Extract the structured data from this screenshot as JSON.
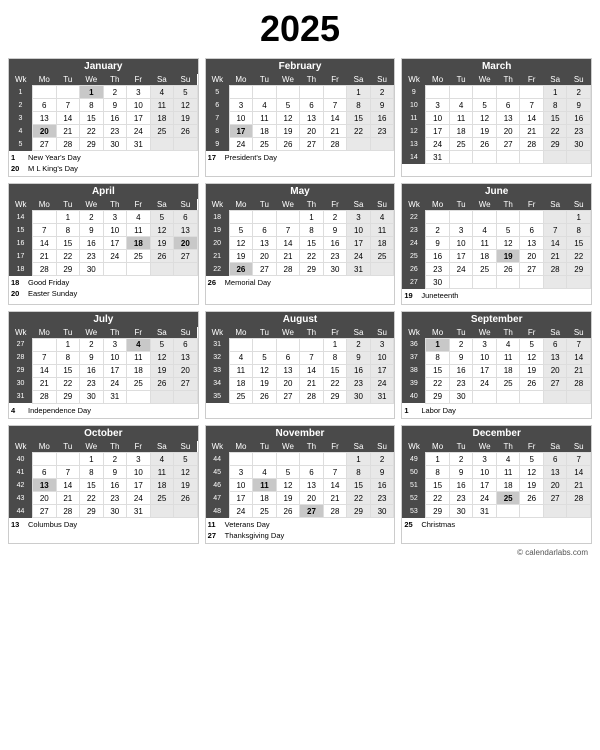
{
  "title": "2025",
  "footer": "© calendarlabs.com",
  "months": [
    {
      "name": "January",
      "headers": [
        "Wk",
        "Mo",
        "Tu",
        "We",
        "Th",
        "Fr",
        "Sa",
        "Su"
      ],
      "rows": [
        [
          "1",
          "",
          "",
          "1",
          "2",
          "3",
          "4",
          "5"
        ],
        [
          "2",
          "6",
          "7",
          "8",
          "9",
          "10",
          "11",
          "12"
        ],
        [
          "3",
          "13",
          "14",
          "15",
          "16",
          "17",
          "18",
          "19"
        ],
        [
          "4",
          "20",
          "21",
          "22",
          "23",
          "24",
          "25",
          "26"
        ],
        [
          "5",
          "27",
          "28",
          "29",
          "30",
          "31",
          "",
          ""
        ]
      ],
      "holidays": [
        {
          "date": "1",
          "name": "New Year's Day"
        },
        {
          "date": "20",
          "name": "M L King's Day"
        }
      ],
      "holiday_dates": [
        "1",
        "20"
      ],
      "sat_col": 6,
      "sun_col": 7
    },
    {
      "name": "February",
      "headers": [
        "Wk",
        "Mo",
        "Tu",
        "We",
        "Th",
        "Fr",
        "Sa",
        "Su"
      ],
      "rows": [
        [
          "5",
          "",
          "",
          "",
          "",
          "",
          "1",
          "2"
        ],
        [
          "6",
          "3",
          "4",
          "5",
          "6",
          "7",
          "8",
          "9"
        ],
        [
          "7",
          "10",
          "11",
          "12",
          "13",
          "14",
          "15",
          "16"
        ],
        [
          "8",
          "17",
          "18",
          "19",
          "20",
          "21",
          "22",
          "23"
        ],
        [
          "9",
          "24",
          "25",
          "26",
          "27",
          "28",
          "",
          ""
        ]
      ],
      "holidays": [
        {
          "date": "17",
          "name": "President's Day"
        }
      ],
      "holiday_dates": [
        "17"
      ],
      "sat_col": 6,
      "sun_col": 7
    },
    {
      "name": "March",
      "headers": [
        "Wk",
        "Mo",
        "Tu",
        "We",
        "Th",
        "Fr",
        "Sa",
        "Su"
      ],
      "rows": [
        [
          "9",
          "",
          "",
          "",
          "",
          "",
          "1",
          "2"
        ],
        [
          "10",
          "3",
          "4",
          "5",
          "6",
          "7",
          "8",
          "9"
        ],
        [
          "11",
          "10",
          "11",
          "12",
          "13",
          "14",
          "15",
          "16"
        ],
        [
          "12",
          "17",
          "18",
          "19",
          "20",
          "21",
          "22",
          "23"
        ],
        [
          "13",
          "24",
          "25",
          "26",
          "27",
          "28",
          "29",
          "30"
        ],
        [
          "14",
          "31",
          "",
          "",
          "",
          "",
          "",
          ""
        ]
      ],
      "holidays": [],
      "holiday_dates": [],
      "sat_col": 6,
      "sun_col": 7
    },
    {
      "name": "April",
      "headers": [
        "Wk",
        "Mo",
        "Tu",
        "We",
        "Th",
        "Fr",
        "Sa",
        "Su"
      ],
      "rows": [
        [
          "14",
          "",
          "1",
          "2",
          "3",
          "4",
          "5",
          "6"
        ],
        [
          "15",
          "7",
          "8",
          "9",
          "10",
          "11",
          "12",
          "13"
        ],
        [
          "16",
          "14",
          "15",
          "16",
          "17",
          "18",
          "19",
          "20"
        ],
        [
          "17",
          "21",
          "22",
          "23",
          "24",
          "25",
          "26",
          "27"
        ],
        [
          "18",
          "28",
          "29",
          "30",
          "",
          "",
          "",
          ""
        ]
      ],
      "holidays": [
        {
          "date": "18",
          "name": "Good Friday"
        },
        {
          "date": "20",
          "name": "Easter Sunday"
        }
      ],
      "holiday_dates": [
        "18",
        "20"
      ],
      "sat_col": 6,
      "sun_col": 7
    },
    {
      "name": "May",
      "headers": [
        "Wk",
        "Mo",
        "Tu",
        "We",
        "Th",
        "Fr",
        "Sa",
        "Su"
      ],
      "rows": [
        [
          "18",
          "",
          "",
          "",
          "1",
          "2",
          "3",
          "4"
        ],
        [
          "19",
          "5",
          "6",
          "7",
          "8",
          "9",
          "10",
          "11"
        ],
        [
          "20",
          "12",
          "13",
          "14",
          "15",
          "16",
          "17",
          "18"
        ],
        [
          "21",
          "19",
          "20",
          "21",
          "22",
          "23",
          "24",
          "25"
        ],
        [
          "22",
          "26",
          "27",
          "28",
          "29",
          "30",
          "31",
          ""
        ]
      ],
      "holidays": [
        {
          "date": "26",
          "name": "Memorial Day"
        }
      ],
      "holiday_dates": [
        "26"
      ],
      "sat_col": 6,
      "sun_col": 7
    },
    {
      "name": "June",
      "headers": [
        "Wk",
        "Mo",
        "Tu",
        "We",
        "Th",
        "Fr",
        "Sa",
        "Su"
      ],
      "rows": [
        [
          "22",
          "",
          "",
          "",
          "",
          "",
          "",
          "1"
        ],
        [
          "23",
          "2",
          "3",
          "4",
          "5",
          "6",
          "7",
          "8"
        ],
        [
          "24",
          "9",
          "10",
          "11",
          "12",
          "13",
          "14",
          "15"
        ],
        [
          "25",
          "16",
          "17",
          "18",
          "19",
          "20",
          "21",
          "22"
        ],
        [
          "26",
          "23",
          "24",
          "25",
          "26",
          "27",
          "28",
          "29"
        ],
        [
          "27",
          "30",
          "",
          "",
          "",
          "",
          "",
          ""
        ]
      ],
      "holidays": [
        {
          "date": "19",
          "name": "Juneteenth"
        }
      ],
      "holiday_dates": [
        "19"
      ],
      "sat_col": 6,
      "sun_col": 7
    },
    {
      "name": "July",
      "headers": [
        "Wk",
        "Mo",
        "Tu",
        "We",
        "Th",
        "Fr",
        "Sa",
        "Su"
      ],
      "rows": [
        [
          "27",
          "",
          "1",
          "2",
          "3",
          "4",
          "5",
          "6"
        ],
        [
          "28",
          "7",
          "8",
          "9",
          "10",
          "11",
          "12",
          "13"
        ],
        [
          "29",
          "14",
          "15",
          "16",
          "17",
          "18",
          "19",
          "20"
        ],
        [
          "30",
          "21",
          "22",
          "23",
          "24",
          "25",
          "26",
          "27"
        ],
        [
          "31",
          "28",
          "29",
          "30",
          "31",
          "",
          "",
          ""
        ]
      ],
      "holidays": [
        {
          "date": "4",
          "name": "Independence Day"
        }
      ],
      "holiday_dates": [
        "4"
      ],
      "sat_col": 6,
      "sun_col": 7
    },
    {
      "name": "August",
      "headers": [
        "Wk",
        "Mo",
        "Tu",
        "We",
        "Th",
        "Fr",
        "Sa",
        "Su"
      ],
      "rows": [
        [
          "31",
          "",
          "",
          "",
          "",
          "1",
          "2",
          "3"
        ],
        [
          "32",
          "4",
          "5",
          "6",
          "7",
          "8",
          "9",
          "10"
        ],
        [
          "33",
          "11",
          "12",
          "13",
          "14",
          "15",
          "16",
          "17"
        ],
        [
          "34",
          "18",
          "19",
          "20",
          "21",
          "22",
          "23",
          "24"
        ],
        [
          "35",
          "25",
          "26",
          "27",
          "28",
          "29",
          "30",
          "31"
        ]
      ],
      "holidays": [],
      "holiday_dates": [],
      "sat_col": 6,
      "sun_col": 7
    },
    {
      "name": "September",
      "headers": [
        "Wk",
        "Mo",
        "Tu",
        "We",
        "Th",
        "Fr",
        "Sa",
        "Su"
      ],
      "rows": [
        [
          "36",
          "1",
          "2",
          "3",
          "4",
          "5",
          "6",
          "7"
        ],
        [
          "37",
          "8",
          "9",
          "10",
          "11",
          "12",
          "13",
          "14"
        ],
        [
          "38",
          "15",
          "16",
          "17",
          "18",
          "19",
          "20",
          "21"
        ],
        [
          "39",
          "22",
          "23",
          "24",
          "25",
          "26",
          "27",
          "28"
        ],
        [
          "40",
          "29",
          "30",
          "",
          "",
          "",
          "",
          ""
        ]
      ],
      "holidays": [
        {
          "date": "1",
          "name": "Labor Day"
        }
      ],
      "holiday_dates": [
        "1"
      ],
      "sat_col": 6,
      "sun_col": 7
    },
    {
      "name": "October",
      "headers": [
        "Wk",
        "Mo",
        "Tu",
        "We",
        "Th",
        "Fr",
        "Sa",
        "Su"
      ],
      "rows": [
        [
          "40",
          "",
          "",
          "1",
          "2",
          "3",
          "4",
          "5"
        ],
        [
          "41",
          "6",
          "7",
          "8",
          "9",
          "10",
          "11",
          "12"
        ],
        [
          "42",
          "13",
          "14",
          "15",
          "16",
          "17",
          "18",
          "19"
        ],
        [
          "43",
          "20",
          "21",
          "22",
          "23",
          "24",
          "25",
          "26"
        ],
        [
          "44",
          "27",
          "28",
          "29",
          "30",
          "31",
          "",
          ""
        ]
      ],
      "holidays": [
        {
          "date": "13",
          "name": "Columbus Day"
        }
      ],
      "holiday_dates": [
        "13"
      ],
      "sat_col": 6,
      "sun_col": 7
    },
    {
      "name": "November",
      "headers": [
        "Wk",
        "Mo",
        "Tu",
        "We",
        "Th",
        "Fr",
        "Sa",
        "Su"
      ],
      "rows": [
        [
          "44",
          "",
          "",
          "",
          "",
          "",
          "1",
          "2"
        ],
        [
          "45",
          "3",
          "4",
          "5",
          "6",
          "7",
          "8",
          "9"
        ],
        [
          "46",
          "10",
          "11",
          "12",
          "13",
          "14",
          "15",
          "16"
        ],
        [
          "47",
          "17",
          "18",
          "19",
          "20",
          "21",
          "22",
          "23"
        ],
        [
          "48",
          "24",
          "25",
          "26",
          "27",
          "28",
          "29",
          "30"
        ]
      ],
      "holidays": [
        {
          "date": "11",
          "name": "Veterans Day"
        },
        {
          "date": "27",
          "name": "Thanksgiving Day"
        }
      ],
      "holiday_dates": [
        "11",
        "27"
      ],
      "sat_col": 6,
      "sun_col": 7
    },
    {
      "name": "December",
      "headers": [
        "Wk",
        "Mo",
        "Tu",
        "We",
        "Th",
        "Fr",
        "Sa",
        "Su"
      ],
      "rows": [
        [
          "49",
          "1",
          "2",
          "3",
          "4",
          "5",
          "6",
          "7"
        ],
        [
          "50",
          "8",
          "9",
          "10",
          "11",
          "12",
          "13",
          "14"
        ],
        [
          "51",
          "15",
          "16",
          "17",
          "18",
          "19",
          "20",
          "21"
        ],
        [
          "52",
          "22",
          "23",
          "24",
          "25",
          "26",
          "27",
          "28"
        ],
        [
          "53",
          "29",
          "30",
          "31",
          "",
          "",
          "",
          ""
        ]
      ],
      "holidays": [
        {
          "date": "25",
          "name": "Christmas"
        }
      ],
      "holiday_dates": [
        "25"
      ],
      "sat_col": 6,
      "sun_col": 7
    }
  ]
}
